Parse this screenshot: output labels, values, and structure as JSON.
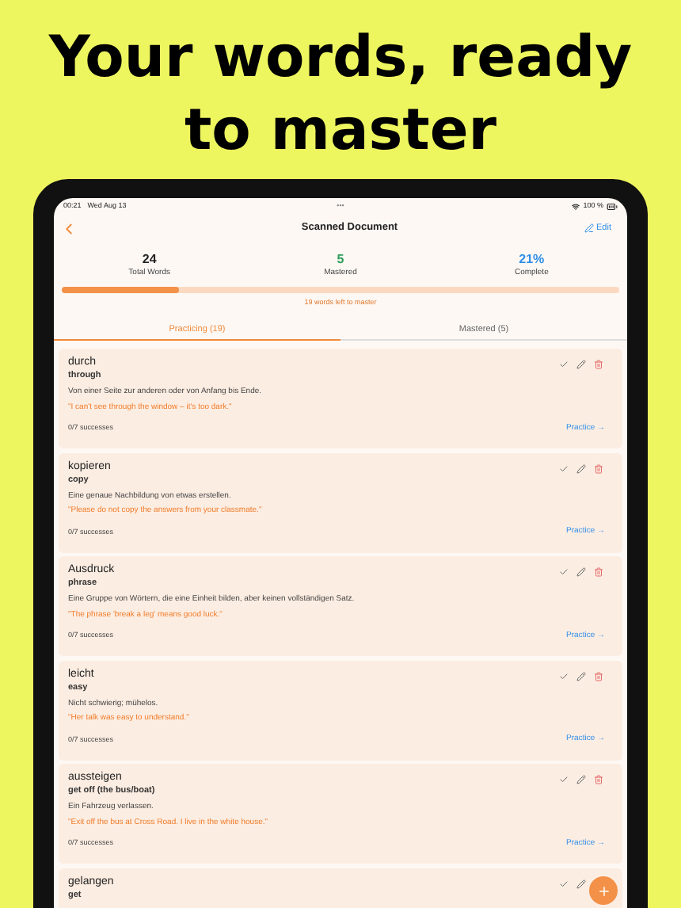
{
  "headline": "Your words, ready to master",
  "status_bar": {
    "time": "00:21",
    "date": "Wed Aug 13",
    "dots": "•••",
    "battery": "100 %"
  },
  "nav": {
    "title": "Scanned Document",
    "edit": "Edit"
  },
  "stats": [
    {
      "value": "24",
      "label": "Total Words",
      "kind": "total"
    },
    {
      "value": "5",
      "label": "Mastered",
      "kind": "mastered"
    },
    {
      "value": "21%",
      "label": "Complete",
      "kind": "complete"
    }
  ],
  "progress": {
    "level": 0.21,
    "caption": "19 words left to master"
  },
  "tabs": [
    {
      "label": "Practicing (19)",
      "selected": true
    },
    {
      "label": "Mastered (5)",
      "selected": false
    }
  ],
  "words": [
    {
      "word": "durch",
      "translation": "through",
      "definition": "Von einer Seite zur anderen oder von Anfang bis Ende.",
      "example": "\"I can't see through the window – it's too dark.\"",
      "successes": "0/7 successes",
      "action": "Practice →"
    },
    {
      "word": "kopieren",
      "translation": "copy",
      "definition": "Eine genaue Nachbildung von etwas erstellen.",
      "example": "\"Please do not copy the answers from your classmate.\"",
      "successes": "0/7 successes",
      "action": "Practice →"
    },
    {
      "word": "Ausdruck",
      "translation": "phrase",
      "definition": "Eine Gruppe von Wörtern, die eine Einheit bilden, aber keinen vollständigen Satz.",
      "example": "\"The phrase 'break a leg' means good luck.\"",
      "successes": "0/7 successes",
      "action": "Practice →"
    },
    {
      "word": "leicht",
      "translation": "easy",
      "definition": "Nicht schwierig; mühelos.",
      "example": "\"Her talk was easy to understand.\"",
      "successes": "0/7 successes",
      "action": "Practice →"
    },
    {
      "word": "aussteigen",
      "translation": "get off (the bus/boat)",
      "definition": "Ein Fahrzeug verlassen.",
      "example": "\"Exit off the bus at Cross Road. I live in the white house.\"",
      "successes": "0/7 successes",
      "action": "Practice →"
    },
    {
      "word": "gelangen",
      "translation": "get"
    }
  ]
}
